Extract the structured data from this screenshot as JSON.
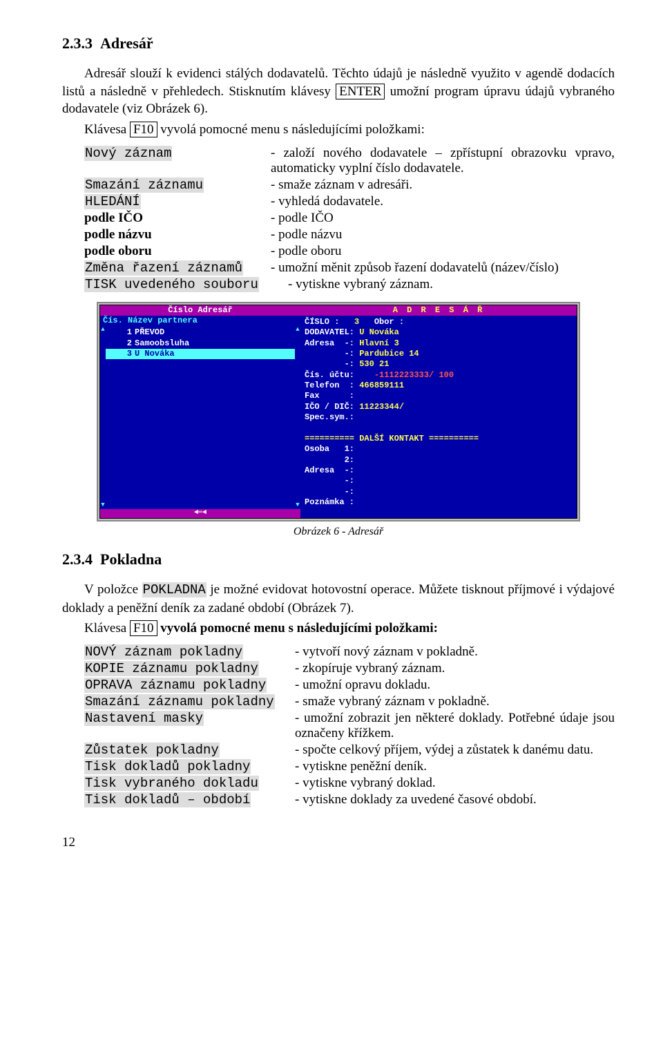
{
  "section1": {
    "num": "2.3.3",
    "title": "Adresář",
    "p1a": "Adresář slouží k evidenci stálých dodavatelů. Těchto údajů je následně využito v agendě dodacích listů a následně v přehledech. Stisknutím klávesy ",
    "key1": "ENTER",
    "p1b": " umožní program úpravu údajů vybraného dodavatele (viz Obrázek 6).",
    "p2a": "Klávesa ",
    "key2": "F10",
    "p2b": " vyvolá pomocné menu s následujícími položkami:"
  },
  "menu1": [
    {
      "left": "Nový záznam",
      "right": "- založí nového dodavatele – zpřístupní obrazovku vpravo, automaticky vyplní číslo dodavatele.",
      "hl": true
    },
    {
      "left": "Smazání záznamu",
      "right": "- smaže záznam v adresáři.",
      "hl": true
    },
    {
      "left": "HLEDÁNÍ",
      "right": "- vyhledá dodavatele.",
      "hl": true
    },
    {
      "left": "podle IČO",
      "right": "- podle IČO",
      "bold": true
    },
    {
      "left": "podle názvu",
      "right": "- podle názvu",
      "bold": true
    },
    {
      "left": "podle oboru",
      "right": "- podle oboru",
      "bold": true
    },
    {
      "left": "Změna řazení záznamů",
      "right": "- umožní měnit způsob řazení dodavatelů (název/číslo)",
      "hl": true
    },
    {
      "left": "TISK uvedeného souboru",
      "right": "- vytiskne vybraný záznam.",
      "hl": true,
      "nowrap": true
    }
  ],
  "dos": {
    "top_left": "Číslo    Adresář",
    "left_header": "Čís.    Název partnera",
    "list": [
      {
        "n": "1",
        "name": "PŘEVOD",
        "sel": false
      },
      {
        "n": "2",
        "name": "Samoobsluha",
        "sel": false
      },
      {
        "n": "3",
        "name": "U Nováka",
        "sel": true
      }
    ],
    "title_right": "A D R E S Á Ř",
    "fields": [
      {
        "lbl": "ČÍSLO :   ",
        "val": "3",
        "vy": true,
        "after": "   Obor :"
      },
      {
        "lbl": "DODAVATEL: ",
        "val": "U Nováka",
        "vy": true
      },
      {
        "lbl": "Adresa  -: ",
        "val": "Hlavní 3",
        "vy": true
      },
      {
        "lbl": "        -: ",
        "val": "Pardubice 14",
        "vy": true
      },
      {
        "lbl": "        -: ",
        "val": "530 21",
        "vy": true
      },
      {
        "lbl": "Čís. účtu:    ",
        "val": "-1112223333/ 100",
        "vr": true
      },
      {
        "lbl": "Telefon  : ",
        "val": "466859111",
        "vy": true
      },
      {
        "lbl": "Fax      :",
        "val": ""
      },
      {
        "lbl": "IČO / DIČ: ",
        "val": "11223344/",
        "vy": true
      },
      {
        "lbl": "Spec.sym.:",
        "val": ""
      },
      {
        "lbl": "",
        "val": ""
      },
      {
        "lbl": "========== DALŠÍ KONTAKT ==========",
        "val": "",
        "lbl_yellow": true
      },
      {
        "lbl": "Osoba   1:",
        "val": ""
      },
      {
        "lbl": "        2:",
        "val": ""
      },
      {
        "lbl": "Adresa  -:",
        "val": ""
      },
      {
        "lbl": "        -:",
        "val": ""
      },
      {
        "lbl": "        -:",
        "val": ""
      },
      {
        "lbl": "Poznámka :",
        "val": ""
      }
    ],
    "bottom_arrows": "◄═◄"
  },
  "caption": "Obrázek 6 - Adresář",
  "section2": {
    "num": "2.3.4",
    "title": "Pokladna",
    "p1a": "V položce ",
    "p1code": "POKLADNA",
    "p1b": " je možné evidovat hotovostní operace. Můžete tisknout příjmové i výdajové doklady a peněžní deník za zadané období (Obrázek 7).",
    "p2a": "Klávesa ",
    "key": "F10",
    "p2b": " vyvolá pomocné menu s následujícími položkami:"
  },
  "menu2": [
    {
      "left": "NOVÝ záznam pokladny",
      "right": "- vytvoří nový záznam v pokladně."
    },
    {
      "left": "KOPIE záznamu pokladny",
      "right": "- zkopíruje vybraný záznam."
    },
    {
      "left": "OPRAVA záznamu pokladny",
      "right": "- umožní opravu dokladu."
    },
    {
      "left": "Smazání záznamu pokladny",
      "right": "- smaže vybraný záznam v pokladně.",
      "nowrap": true
    },
    {
      "left": "Nastavení masky",
      "right": "- umožní zobrazit jen některé doklady. Potřebné údaje jsou označeny křížkem."
    },
    {
      "left": "Zůstatek pokladny",
      "right": "- spočte celkový příjem, výdej a zůstatek k danému datu."
    },
    {
      "left": "Tisk dokladů pokladny",
      "right": "- vytiskne peněžní deník."
    },
    {
      "left": "Tisk vybraného dokladu",
      "right": "- vytiskne vybraný doklad."
    },
    {
      "left": "Tisk dokladů – období",
      "right": "- vytiskne doklady za uvedené časové období."
    }
  ],
  "pagenum": "12"
}
